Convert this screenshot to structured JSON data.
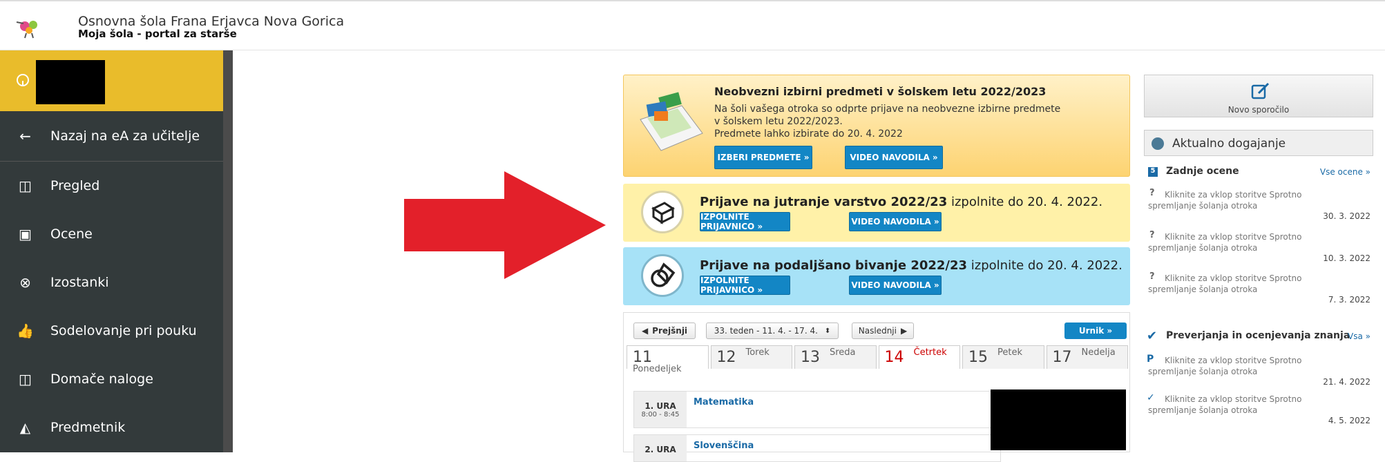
{
  "header": {
    "school": "Osnovna šola Frana Erjavca Nova Gorica",
    "portal": "Moja šola - portal za starše"
  },
  "sidebar": {
    "back": "Nazaj na eA za učitelje",
    "items": [
      {
        "label": "Pregled",
        "icon": "book-icon"
      },
      {
        "label": "Ocene",
        "icon": "grades-icon"
      },
      {
        "label": "Izostanki",
        "icon": "absence-icon"
      },
      {
        "label": "Sodelovanje pri pouku",
        "icon": "thumbs-up-icon"
      },
      {
        "label": "Domače naloge",
        "icon": "book-icon"
      },
      {
        "label": "Predmetnik",
        "icon": "ruler-icon"
      }
    ]
  },
  "cards": {
    "izbirni": {
      "title": "Neobvezni izbirni predmeti v šolskem letu 2022/2023",
      "line1": "Na šoli vašega otroka so odprte prijave na neobvezne izbirne predmete",
      "line2": "v šolskem letu 2022/2023.",
      "line3": "Predmete lahko izbirate do 20. 4. 2022",
      "btn1": "IZBERI PREDMETE »",
      "btn2": "VIDEO NAVODILA »"
    },
    "varstvo": {
      "title_bold": "Prijave na jutranje varstvo 2022/23",
      "title_rest": " izpolnite do 20. 4. 2022.",
      "btn1": "IZPOLNITE PRIJAVNICO »",
      "btn2": "VIDEO NAVODILA »"
    },
    "bivanje": {
      "title_bold": "Prijave na podaljšano bivanje 2022/23",
      "title_rest": " izpolnite do 20. 4. 2022.",
      "btn1": "IZPOLNITE PRIJAVNICO »",
      "btn2": "VIDEO NAVODILA »"
    }
  },
  "schedule": {
    "prev": "Prejšnji",
    "week": "33. teden - 11. 4. - 17. 4.",
    "next": "Naslednji",
    "urnik": "Urnik »",
    "days": [
      {
        "num": "11",
        "name": "Ponedeljek"
      },
      {
        "num": "12",
        "name": "Torek"
      },
      {
        "num": "13",
        "name": "Sreda"
      },
      {
        "num": "14",
        "name": "Četrtek"
      },
      {
        "num": "15",
        "name": "Petek"
      },
      {
        "num": "17",
        "name": "Nedelja"
      }
    ],
    "lessons": [
      {
        "ura": "1. URA",
        "time": "8:00 - 8:45",
        "subject": "Matematika"
      },
      {
        "ura": "2. URA",
        "time": "",
        "subject": "Slovenščina"
      }
    ]
  },
  "right": {
    "novo": "Novo sporočilo",
    "aktualno": "Aktualno dogajanje",
    "ocene_title": "Zadnje ocene",
    "ocene_link": "Vse ocene »",
    "preverjanja_title": "Preverjanja in ocenjevanja znanja",
    "preverjanja_link": "Vsa »",
    "item_text": "Kliknite za vklop storitve Sprotno spremljanje šolanja otroka",
    "ocene_dates": [
      "30. 3. 2022",
      "10. 3. 2022",
      "7. 3. 2022"
    ],
    "prev_dates": [
      "21. 4. 2022",
      "4. 5. 2022"
    ]
  },
  "colors": {
    "accent": "#1386c5",
    "sidebar": "#333a3b",
    "user": "#e9bc2b",
    "arrow": "#e3202a"
  }
}
